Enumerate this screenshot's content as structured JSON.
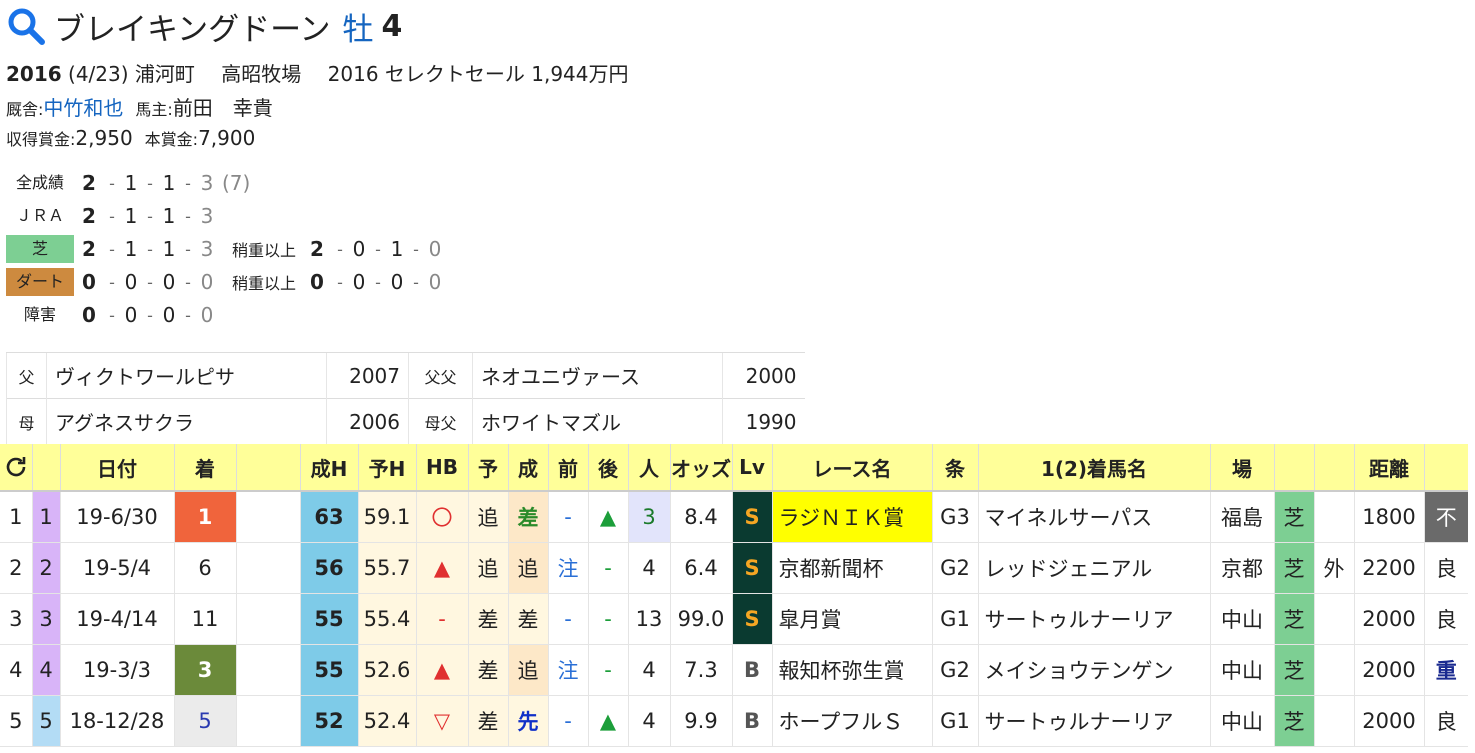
{
  "horse": {
    "name": "ブレイキングドーン",
    "sex": "牡",
    "age": "4",
    "birth_year": "2016",
    "birth_date": "(4/23)",
    "birthplace": "浦河町",
    "breeder": "高昭牧場",
    "sale": "2016 セレクトセール 1,944万円",
    "trainer_label": "厩舎:",
    "trainer": "中竹和也",
    "owner_label": "馬主:",
    "owner": "前田　幸貴",
    "earn_label": "収得賞金:",
    "earn": "2,950",
    "prize_label": "本賞金:",
    "prize": "7,900"
  },
  "records": [
    {
      "label": "全成績",
      "vals": [
        "2",
        "1",
        "1",
        "3"
      ],
      "total": "(7)"
    },
    {
      "label": "ＪＲＡ",
      "vals": [
        "2",
        "1",
        "1",
        "3"
      ]
    },
    {
      "label": "芝",
      "vals": [
        "2",
        "1",
        "1",
        "3"
      ],
      "heavy_label": "稍重以上",
      "heavy": [
        "2",
        "0",
        "1",
        "0"
      ]
    },
    {
      "label": "ダート",
      "vals": [
        "0",
        "0",
        "0",
        "0"
      ],
      "heavy_label": "稍重以上",
      "heavy": [
        "0",
        "0",
        "0",
        "0"
      ]
    },
    {
      "label": "障害",
      "vals": [
        "0",
        "0",
        "0",
        "0"
      ]
    }
  ],
  "pedigree": [
    {
      "k1": "父",
      "n1": "ヴィクトワールピサ",
      "y1": "2007",
      "k2": "父父",
      "n2": "ネオユニヴァース",
      "y2": "2000"
    },
    {
      "k1": "母",
      "n1": "アグネスサクラ",
      "y1": "2006",
      "k2": "母父",
      "n2": "ホワイトマズル",
      "y2": "1990"
    }
  ],
  "race_headers": [
    "",
    "",
    "日付",
    "着",
    "",
    "成H",
    "予H",
    "HB",
    "予",
    "成",
    "前",
    "後",
    "人",
    "オッズ",
    "Lv",
    "レース名",
    "条",
    "1(2)着馬名",
    "場",
    "",
    "",
    "距離",
    ""
  ],
  "races": [
    {
      "idx": "1",
      "no": "1",
      "date": "19-6/30",
      "pos": "1",
      "perf": "63",
      "yh": "59.1",
      "hb": "〇",
      "yo": "追",
      "sei": "差",
      "mae": "-",
      "ato": "▲",
      "pop": "3",
      "odds": "8.4",
      "lv": "S",
      "race": "ラジＮＩＫ賞",
      "grade": "G3",
      "winner": "マイネルサーパス",
      "venue": "福島",
      "surface": "芝",
      "course": "",
      "dist": "1800",
      "cond": "不"
    },
    {
      "idx": "2",
      "no": "2",
      "date": "19-5/4",
      "pos": "6",
      "perf": "56",
      "yh": "55.7",
      "hb": "▲",
      "yo": "追",
      "sei": "追",
      "mae": "注",
      "ato": "-",
      "pop": "4",
      "odds": "6.4",
      "lv": "S",
      "race": "京都新聞杯",
      "grade": "G2",
      "winner": "レッドジェニアル",
      "venue": "京都",
      "surface": "芝",
      "course": "外",
      "dist": "2200",
      "cond": "良"
    },
    {
      "idx": "3",
      "no": "3",
      "date": "19-4/14",
      "pos": "11",
      "perf": "55",
      "yh": "55.4",
      "hb": "-",
      "yo": "差",
      "sei": "差",
      "mae": "-",
      "ato": "-",
      "pop": "13",
      "odds": "99.0",
      "lv": "S",
      "race": "皐月賞",
      "grade": "G1",
      "winner": "サートゥルナーリア",
      "venue": "中山",
      "surface": "芝",
      "course": "",
      "dist": "2000",
      "cond": "良"
    },
    {
      "idx": "4",
      "no": "4",
      "date": "19-3/3",
      "pos": "3",
      "perf": "55",
      "yh": "52.6",
      "hb": "▲",
      "yo": "差",
      "sei": "追",
      "mae": "注",
      "ato": "-",
      "pop": "4",
      "odds": "7.3",
      "lv": "B",
      "race": "報知杯弥生賞",
      "grade": "G2",
      "winner": "メイショウテンゲン",
      "venue": "中山",
      "surface": "芝",
      "course": "",
      "dist": "2000",
      "cond": "重"
    },
    {
      "idx": "5",
      "no": "5",
      "date": "18-12/28",
      "pos": "5",
      "perf": "52",
      "yh": "52.4",
      "hb": "▽",
      "yo": "差",
      "sei": "先",
      "mae": "-",
      "ato": "▲",
      "pop": "4",
      "odds": "9.9",
      "lv": "B",
      "race": "ホープフルＳ",
      "grade": "G1",
      "winner": "サートゥルナーリア",
      "venue": "中山",
      "surface": "芝",
      "course": "",
      "dist": "2000",
      "cond": "良"
    }
  ],
  "colors": {
    "accent": "#1565c0",
    "turf": "#7dcf93",
    "dirt": "#cd8a3f",
    "header": "#ffff99",
    "win": "#f0643c"
  },
  "icons": {
    "search": "search-icon",
    "refresh": "refresh-icon"
  }
}
